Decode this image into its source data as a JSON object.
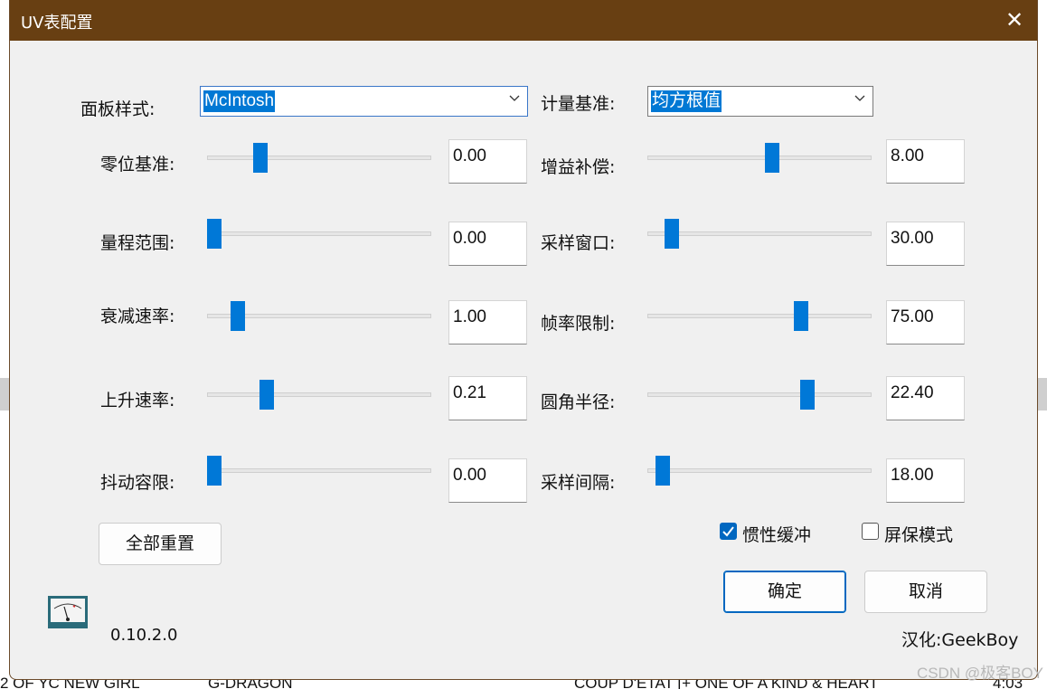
{
  "window": {
    "title": "UV表配置",
    "close_glyph": "✕"
  },
  "panel_style": {
    "label": "面板样式:",
    "value": "McIntosh"
  },
  "measure_basis": {
    "label": "计量基准:",
    "value": "均方根值"
  },
  "left_sliders": [
    {
      "label": "零位基准:",
      "value": "0.00",
      "level": 0.22
    },
    {
      "label": "量程范围:",
      "value": "0.00",
      "level": 0.0
    },
    {
      "label": "衰减速率:",
      "value": "1.00",
      "level": 0.11
    },
    {
      "label": "上升速率:",
      "value": "0.21",
      "level": 0.25
    },
    {
      "label": "抖动容限:",
      "value": "0.00",
      "level": 0.0
    }
  ],
  "right_sliders": [
    {
      "label": "增益补偿:",
      "value": "8.00",
      "level": 0.56
    },
    {
      "label": "采样窗口:",
      "value": "30.00",
      "level": 0.08
    },
    {
      "label": "帧率限制:",
      "value": "75.00",
      "level": 0.7
    },
    {
      "label": "圆角半径:",
      "value": "22.40",
      "level": 0.73
    },
    {
      "label": "采样间隔:",
      "value": "18.00",
      "level": 0.04
    }
  ],
  "buttons": {
    "reset_all": "全部重置",
    "ok": "确定",
    "cancel": "取消"
  },
  "checkboxes": {
    "inertia": {
      "label": "惯性缓冲",
      "checked": true
    },
    "screensaver": {
      "label": "屏保模式",
      "checked": false
    }
  },
  "version": "0.10.2.0",
  "credit": "汉化:GeekBoy",
  "background_text": {
    "left1": "2 OF YC NEW GIRL",
    "left2": "G-DRAGON",
    "right": "COUP D'ETAT [+ ONE OF A KIND & HEART",
    "time": "4:03",
    "watermark": "CSDN @极客BOY"
  },
  "colors": {
    "titlebar": "#683f12",
    "accent": "#0078d7",
    "dialog_bg": "#f0f0f0"
  },
  "icons": {
    "close": "close-icon",
    "dropdown": "chevron-down-icon",
    "app": "vu-meter-icon",
    "check": "check-icon"
  }
}
